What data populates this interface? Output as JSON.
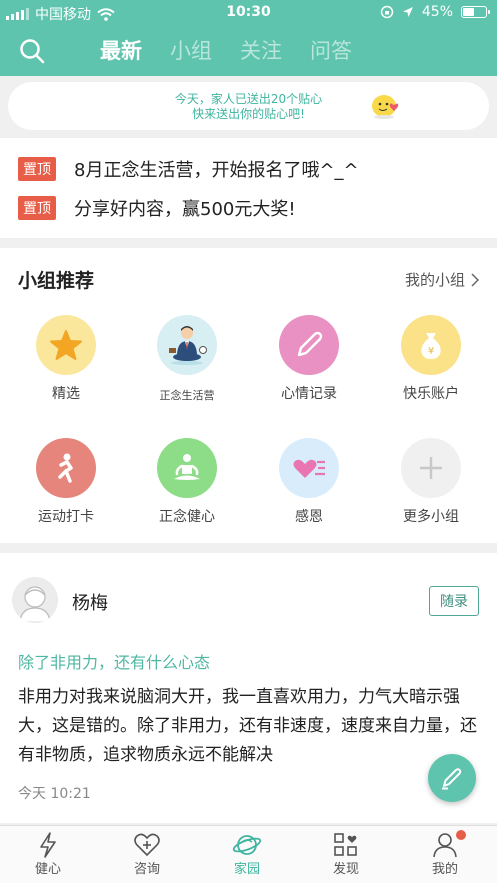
{
  "status_bar": {
    "carrier": "中国移动",
    "time": "10:30",
    "battery": "45%"
  },
  "nav": {
    "tabs": [
      {
        "label": "最新",
        "active": true
      },
      {
        "label": "小组",
        "active": false
      },
      {
        "label": "关注",
        "active": false
      },
      {
        "label": "问答",
        "active": false
      }
    ]
  },
  "banner": {
    "line1": "今天，家人已送出20个贴心",
    "line2": "快来送出你的贴心吧!"
  },
  "pinned": {
    "tag": "置顶",
    "items": [
      "8月正念生活营，开始报名了哦^_^",
      "分享好内容，赢500元大奖!"
    ]
  },
  "groups": {
    "title": "小组推荐",
    "my_groups": "我的小组",
    "items": [
      {
        "label": "精选",
        "icon": "star-icon",
        "color": "#fbe79c"
      },
      {
        "label": "正念生活营",
        "icon": "meditation-man-icon",
        "color": "#d7eef3"
      },
      {
        "label": "心情记录",
        "icon": "pen-icon",
        "color": "#e891c2"
      },
      {
        "label": "快乐账户",
        "icon": "money-bag-icon",
        "color": "#fbe188"
      },
      {
        "label": "运动打卡",
        "icon": "running-icon",
        "color": "#e5857c"
      },
      {
        "label": "正念健心",
        "icon": "yoga-icon",
        "color": "#8ddc87"
      },
      {
        "label": "感恩",
        "icon": "heart-list-icon",
        "color": "#d8ecfb"
      },
      {
        "label": "更多小组",
        "icon": "plus-icon",
        "color": "#f0f0f0"
      }
    ]
  },
  "post": {
    "author": "杨梅",
    "tag_button": "随录",
    "title": "除了非用力，还有什么心态",
    "body": "非用力对我来说脑洞大开，我一直喜欢用力，力气大暗示强大，这是错的。除了非用力，还有非速度，速度来自力量，还有非物质，追求物质永远不能解决",
    "time": "今天 10:21"
  },
  "bottom_nav": [
    {
      "label": "健心",
      "icon": "lightning-icon",
      "active": false
    },
    {
      "label": "咨询",
      "icon": "heart-chat-icon",
      "active": false
    },
    {
      "label": "家园",
      "icon": "planet-icon",
      "active": true
    },
    {
      "label": "发现",
      "icon": "grid-heart-icon",
      "active": false
    },
    {
      "label": "我的",
      "icon": "person-icon",
      "active": false
    }
  ],
  "colors": {
    "primary": "#5ec4ad",
    "pin_tag": "#e85d47"
  }
}
